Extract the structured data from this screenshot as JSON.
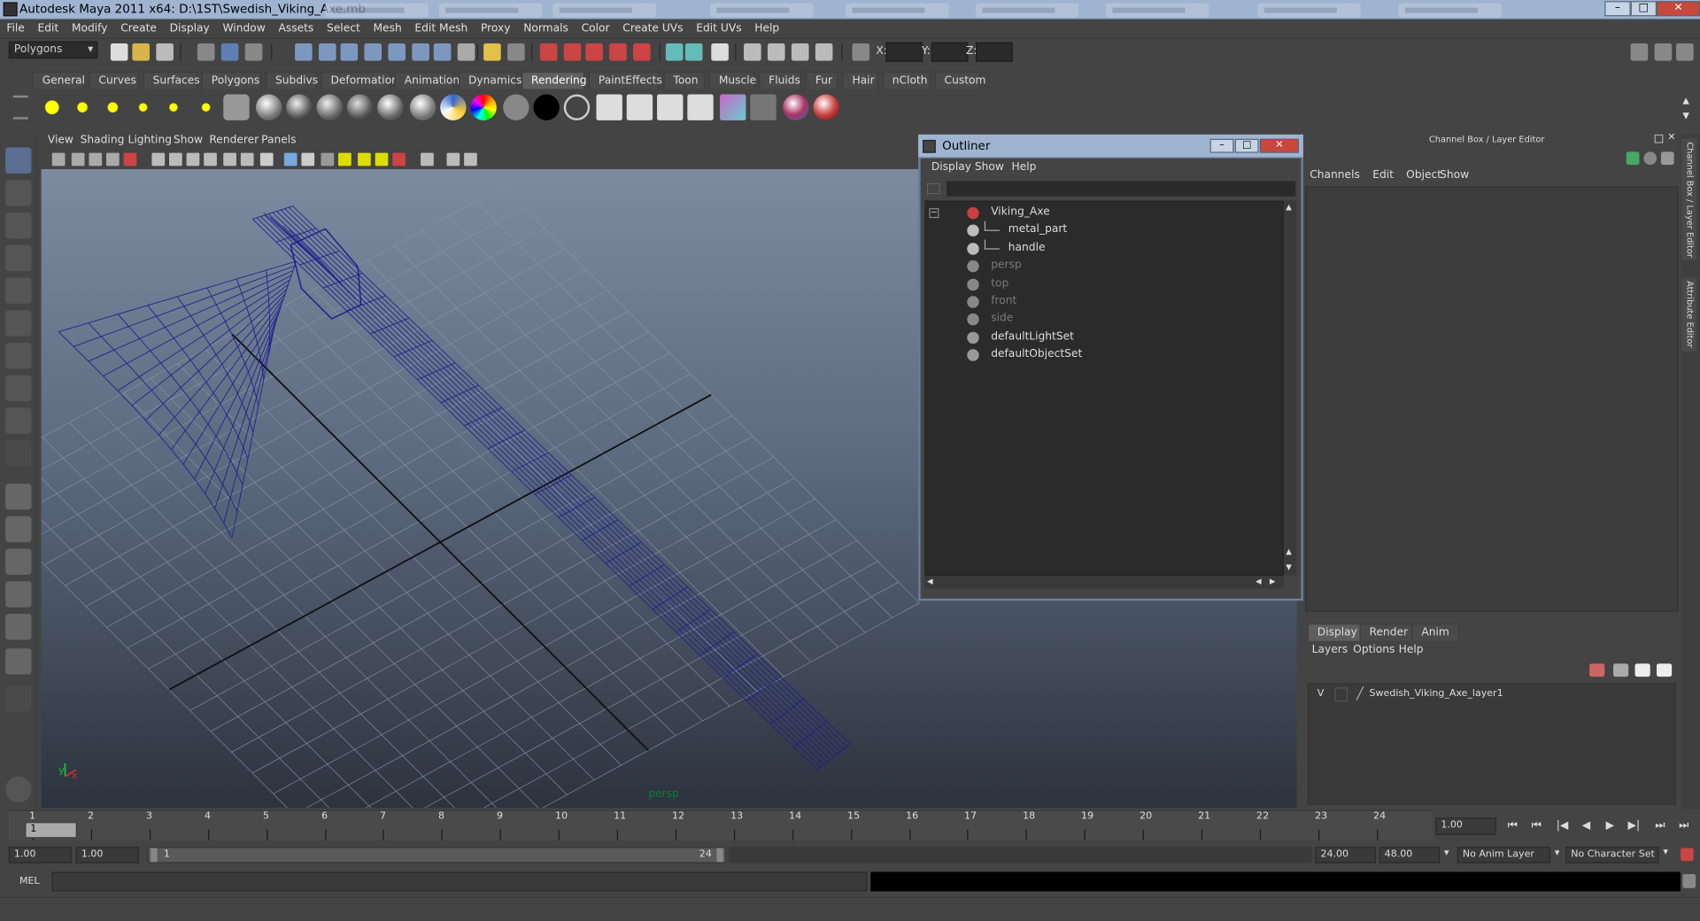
{
  "window": {
    "title": "Autodesk Maya 2011 x64: D:\\1ST\\Swedish_Viking_Axe.mb",
    "minimize": "–",
    "maximize": "□",
    "close": "✕"
  },
  "menubar": [
    "File",
    "Edit",
    "Modify",
    "Create",
    "Display",
    "Window",
    "Assets",
    "Select",
    "Mesh",
    "Edit Mesh",
    "Proxy",
    "Normals",
    "Color",
    "Create UVs",
    "Edit UVs",
    "Help"
  ],
  "statusline": {
    "mode_selector": "Polygons",
    "x_label": "X:",
    "y_label": "Y:",
    "z_label": "Z:",
    "x_value": "",
    "y_value": "",
    "z_value": ""
  },
  "shelf": {
    "tabs": [
      "General",
      "Curves",
      "Surfaces",
      "Polygons",
      "Subdivs",
      "Deformation",
      "Animation",
      "Dynamics",
      "Rendering",
      "PaintEffects",
      "Toon",
      "Muscle",
      "Fluids",
      "Fur",
      "Hair",
      "nCloth",
      "Custom"
    ],
    "active_tab": "Rendering"
  },
  "viewport": {
    "menus": [
      "View",
      "Shading",
      "Lighting",
      "Show",
      "Renderer",
      "Panels"
    ],
    "camera_label": "persp",
    "axis_y": "y",
    "axis_x": "x",
    "wire_color": "#1f1f8c"
  },
  "outliner": {
    "title": "Outliner",
    "menus": [
      "Display",
      "Show",
      "Help"
    ],
    "items": [
      {
        "label": "Viking_Axe",
        "icon": "transform-icon",
        "indent": 0,
        "dim": false
      },
      {
        "label": "metal_part",
        "icon": "mesh-icon",
        "indent": 1,
        "dim": false
      },
      {
        "label": "handle",
        "icon": "mesh-icon",
        "indent": 1,
        "dim": false
      },
      {
        "label": "persp",
        "icon": "camera-icon",
        "indent": 0,
        "dim": true
      },
      {
        "label": "top",
        "icon": "camera-icon",
        "indent": 0,
        "dim": true
      },
      {
        "label": "front",
        "icon": "camera-icon",
        "indent": 0,
        "dim": true
      },
      {
        "label": "side",
        "icon": "camera-icon",
        "indent": 0,
        "dim": true
      },
      {
        "label": "defaultLightSet",
        "icon": "set-icon",
        "indent": 0,
        "dim": false
      },
      {
        "label": "defaultObjectSet",
        "icon": "set-icon",
        "indent": 0,
        "dim": false
      }
    ]
  },
  "channelbox": {
    "header": "Channel Box / Layer Editor",
    "menus": [
      "Channels",
      "Edit",
      "Object",
      "Show"
    ],
    "side_tabs": [
      "Channel Box / Layer Editor",
      "Attribute Editor"
    ]
  },
  "layer_editor": {
    "tabs": [
      "Display",
      "Render",
      "Anim"
    ],
    "active_tab": "Display",
    "menus": [
      "Layers",
      "Options",
      "Help"
    ],
    "layers": [
      {
        "visible": "V",
        "name": "Swedish_Viking_Axe_layer1"
      }
    ]
  },
  "timeslider": {
    "ticks": [
      "1",
      "2",
      "3",
      "4",
      "5",
      "6",
      "7",
      "8",
      "9",
      "10",
      "11",
      "12",
      "13",
      "14",
      "15",
      "16",
      "17",
      "18",
      "19",
      "20",
      "21",
      "22",
      "23",
      "24"
    ],
    "current_marker": "1",
    "current_frame": "1.00"
  },
  "rangeslider": {
    "start_time": "1.00",
    "playback_start": "1.00",
    "range_start": "1",
    "range_end": "24",
    "playback_end": "24.00",
    "end_time": "48.00",
    "anim_layer": "No Anim Layer",
    "character_set": "No Character Set"
  },
  "commandline": {
    "label": "MEL",
    "value": ""
  }
}
